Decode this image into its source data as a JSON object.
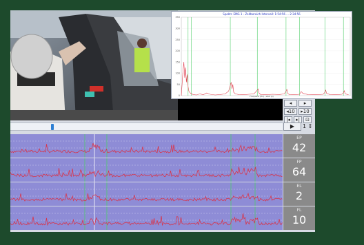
{
  "colors": {
    "background": "#1d4a2c",
    "track_bg": "#8e8cd6",
    "signal": "#d8344a",
    "marker": "#4fcf6a",
    "readout_bg": "#8a8a8a",
    "chart_line": "#e0404f"
  },
  "video": {
    "subject": "factory-worker-video-frame"
  },
  "controls": {
    "buttons": [
      {
        "icon": "step-back-icon",
        "label": "◂"
      },
      {
        "icon": "step-forward-icon",
        "label": "▸"
      },
      {
        "icon": "jump-back-10-icon",
        "label": "◂10"
      },
      {
        "icon": "jump-forward-10-icon",
        "label": "▸10"
      },
      {
        "icon": "go-start-icon",
        "label": "|◂"
      },
      {
        "icon": "go-end-icon",
        "label": "▸|"
      },
      {
        "icon": "fit-icon",
        "label": "⊡"
      }
    ],
    "play_label": "▶",
    "speed_label": "1"
  },
  "scrubber": {
    "position": 0.15
  },
  "tracks": [
    {
      "label": "EP",
      "value": "42"
    },
    {
      "label": "FP",
      "value": "64"
    },
    {
      "label": "EL",
      "value": "2"
    },
    {
      "label": "FL",
      "value": "10"
    }
  ],
  "overlay": {
    "title": "Spektr. EMG 1 - Zeitbereich Intervall: 1:54:56 ... 2:34:56",
    "xlabel": "Frequenz (Hz) / Zeit (s)"
  },
  "chart_data": {
    "type": "line",
    "title": "",
    "xlabel": "",
    "ylabel": "",
    "ylim": [
      0,
      350
    ],
    "xlim": [
      0,
      1000
    ],
    "y_ticks": [
      "350",
      "300",
      "250",
      "200",
      "150",
      "100",
      "50",
      "0"
    ],
    "markers_x": [
      40,
      60,
      290,
      450,
      620,
      700,
      850,
      960
    ],
    "series": [
      {
        "x": [
          0,
          10,
          15,
          20,
          25,
          30,
          35,
          40,
          45,
          55,
          70,
          90,
          110,
          130,
          150,
          170,
          200,
          230,
          260,
          280,
          290,
          295,
          300,
          305,
          310,
          320,
          340,
          370,
          400,
          430,
          450,
          455,
          460,
          470,
          500,
          540,
          580,
          610,
          620,
          625,
          630,
          640,
          670,
          700,
          710,
          720,
          750,
          800,
          840,
          850,
          855,
          860,
          880,
          920,
          950,
          960,
          965,
          970,
          990
        ],
        "y": [
          0,
          110,
          150,
          80,
          125,
          60,
          95,
          40,
          20,
          10,
          5,
          3,
          8,
          4,
          12,
          6,
          3,
          5,
          8,
          20,
          45,
          60,
          30,
          50,
          15,
          8,
          5,
          4,
          6,
          8,
          25,
          30,
          12,
          5,
          4,
          6,
          5,
          8,
          20,
          28,
          10,
          5,
          4,
          6,
          18,
          10,
          5,
          4,
          6,
          15,
          25,
          10,
          5,
          4,
          6,
          12,
          22,
          8,
          4
        ]
      }
    ]
  }
}
